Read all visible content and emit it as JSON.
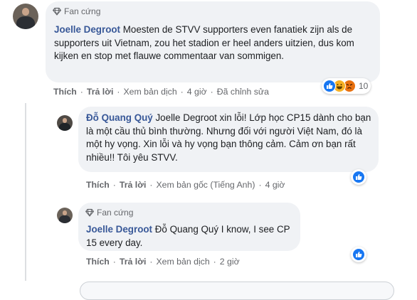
{
  "comments": [
    {
      "badge": "Fan cứng",
      "author": "Joelle Degroot",
      "text": "Moesten de STVV supporters even fanatiek zijn als de supporters uit Vietnam, zou het stadion er heel anders uitzien, dus kom kijken en stop met flauwe commentaar van sommigen.",
      "actions": [
        "Thích",
        "Trả lời",
        "Xem bản dịch",
        "4 giờ",
        "Đã chỉnh sửa"
      ],
      "reaction_count": "10"
    },
    {
      "author": "Đỗ Quang Quý",
      "text": "Joelle Degroot xin lỗi! Lớp học CP15 dành cho bạn là một cầu thủ bình thường. Nhưng đối với người Việt Nam, đó là một hy vọng. Xin lỗi và hy vọng bạn thông cảm. Cảm ơn bạn rất nhiều!! Tôi yêu STVV.",
      "actions": [
        "Thích",
        "Trả lời",
        "Xem bản gốc (Tiếng Anh)",
        "4 giờ"
      ]
    },
    {
      "badge": "Fan cứng",
      "author": "Joelle Degroot",
      "text": "Đỗ Quang Quý I know, I see CP 15 every day.",
      "actions": [
        "Thích",
        "Trả lời",
        "Xem bản dịch",
        "2 giờ"
      ]
    }
  ],
  "icons": {
    "badge": "diamond-icon",
    "reactions": [
      "like-icon",
      "haha-icon",
      "angry-icon"
    ]
  },
  "colors": {
    "name": "#385898",
    "bubble": "#f0f2f5",
    "meta": "#65676b",
    "like": "#1877f2",
    "haha": "#f7b125",
    "angry": "#e9710f"
  }
}
